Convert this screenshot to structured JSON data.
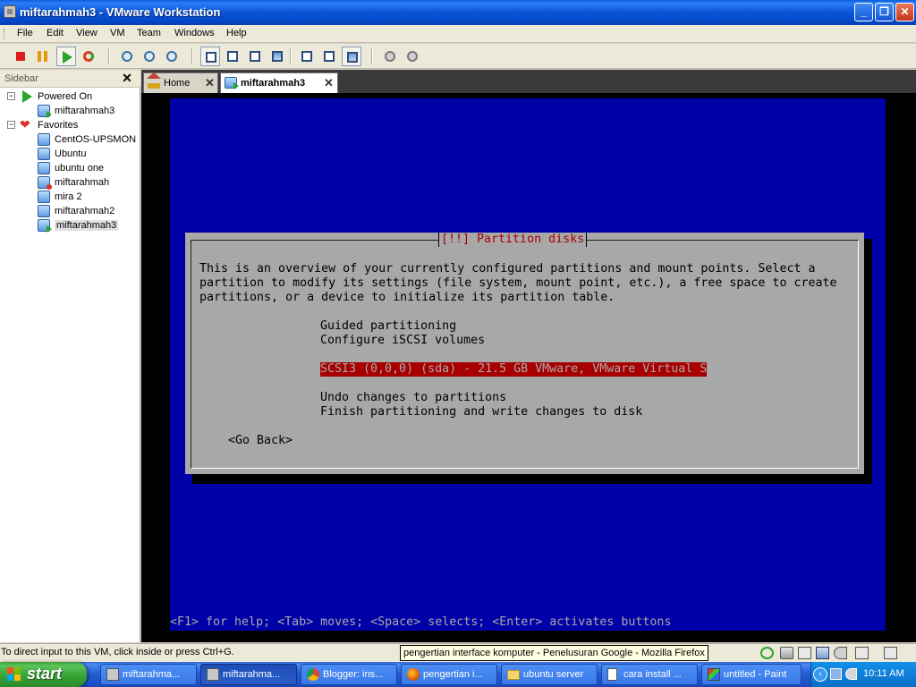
{
  "window": {
    "title": "miftarahmah3 - VMware Workstation",
    "minimize_glyph": "_",
    "maximize_glyph": "❐",
    "close_glyph": "✕"
  },
  "menu": [
    "File",
    "Edit",
    "View",
    "VM",
    "Team",
    "Windows",
    "Help"
  ],
  "toolbar": {
    "icons": [
      "power-off-icon",
      "suspend-icon",
      "power-on-icon",
      "reset-icon",
      "snapshot-icon",
      "revert-snapshot-icon",
      "snapshot-manager-icon",
      "sidebar-view-icon",
      "full-screen-icon",
      "quick-switch-icon",
      "summary-view-icon",
      "console-view-icon",
      "appliance-view-icon",
      "show-console-icon",
      "preferences-icon",
      "settings-icon"
    ]
  },
  "sidebar": {
    "title": "Sidebar",
    "close_glyph": "✕",
    "groups": [
      {
        "label": "Powered On",
        "icon": "power-on-icon",
        "items": [
          {
            "label": "miftarahmah3",
            "state": "on"
          }
        ]
      },
      {
        "label": "Favorites",
        "icon": "heart-icon",
        "items": [
          {
            "label": "CentOS-UPSMON",
            "state": "idle"
          },
          {
            "label": "Ubuntu",
            "state": "idle"
          },
          {
            "label": "ubuntu one",
            "state": "idle"
          },
          {
            "label": "miftarahmah",
            "state": "off"
          },
          {
            "label": "mira 2",
            "state": "idle"
          },
          {
            "label": "miftarahmah2",
            "state": "idle"
          },
          {
            "label": "miftarahmah3",
            "state": "on"
          }
        ]
      }
    ],
    "expander_glyph": "−",
    "heart_glyph": "❤"
  },
  "tabs": [
    {
      "label": "Home",
      "close": "✕"
    },
    {
      "label": "miftarahmah3",
      "close": "✕"
    }
  ],
  "console": {
    "dialog_title": "[!!] Partition disks",
    "intro_lines": [
      "This is an overview of your currently configured partitions and mount points. Select a",
      "partition to modify its settings (file system, mount point, etc.), a free space to create",
      "partitions, or a device to initialize its partition table."
    ],
    "options": [
      "Guided partitioning",
      "Configure iSCSI volumes",
      "SCSI3 (0,0,0) (sda) - 21.5 GB VMware, VMware Virtual S",
      "Undo changes to partitions",
      "Finish partitioning and write changes to disk"
    ],
    "selected_option": 2,
    "back_button": "<Go Back>",
    "help_line": "<F1> for help; <Tab> moves; <Space> selects; <Enter> activates buttons",
    "colors": {
      "screen": "#0000a8",
      "dialog": "#a8a8a8",
      "title": "#a80000",
      "highlight": "#a80000"
    }
  },
  "statusbar": {
    "text": "To direct input to this VM, click inside or press Ctrl+G.",
    "tooltip": "pengertian interface komputer - Penelusuran Google - Mozilla Firefox"
  },
  "taskbar": {
    "start_label": "start",
    "buttons": [
      {
        "label": "miftarahma...",
        "icon": "vmware-icon"
      },
      {
        "label": "miftarahma...",
        "icon": "vmware-icon",
        "active": true
      },
      {
        "label": "Blogger: ins...",
        "icon": "chrome-icon"
      },
      {
        "label": "pengertian i...",
        "icon": "firefox-icon"
      },
      {
        "label": "ubuntu server",
        "icon": "folder-icon"
      },
      {
        "label": "cara install ...",
        "icon": "document-icon"
      },
      {
        "label": "untitled - Paint",
        "icon": "paint-icon"
      }
    ],
    "clock": "10:11 AM",
    "tray_arrow": "‹"
  }
}
